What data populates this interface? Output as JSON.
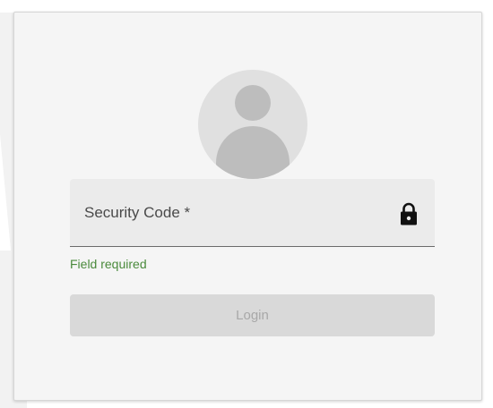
{
  "login_form": {
    "avatar_icon": "person-icon",
    "security_code": {
      "placeholder": "Security Code *",
      "value": "",
      "icon": "lock-icon"
    },
    "hint": "Field required",
    "login_label": "Login"
  },
  "colors": {
    "card_bg": "#f5f5f5",
    "field_bg": "#ebebeb",
    "hint_color": "#4a8a3c",
    "button_disabled_bg": "#d9d9d9",
    "button_disabled_text": "#a8a8a8",
    "avatar_bg": "#e0e0e0",
    "avatar_fg": "#bdbdbd"
  }
}
